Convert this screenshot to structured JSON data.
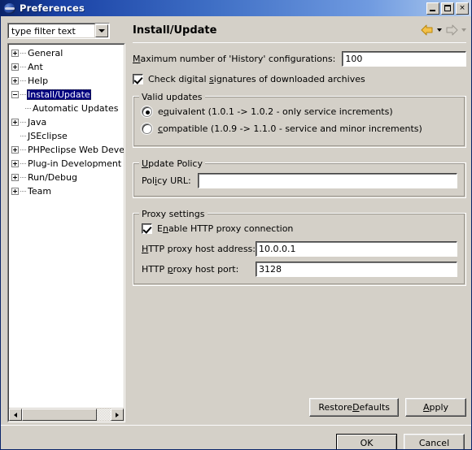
{
  "window": {
    "title": "Preferences",
    "icon": "eclipse-globe-icon",
    "minimize_label": "Minimize",
    "maximize_label": "Maximize",
    "close_label": "×"
  },
  "sidebar": {
    "filter": {
      "value": "type filter text",
      "placeholder": "type filter text"
    },
    "tree": [
      {
        "label": "General",
        "state": "collapsed",
        "level": 0,
        "selected": false
      },
      {
        "label": "Ant",
        "state": "collapsed",
        "level": 0,
        "selected": false
      },
      {
        "label": "Help",
        "state": "collapsed",
        "level": 0,
        "selected": false
      },
      {
        "label": "Install/Update",
        "state": "expanded",
        "level": 0,
        "selected": true
      },
      {
        "label": "Automatic Updates",
        "state": "leaf",
        "level": 1,
        "selected": false
      },
      {
        "label": "Java",
        "state": "collapsed",
        "level": 0,
        "selected": false
      },
      {
        "label": "JSEclipse",
        "state": "leaf",
        "level": 0,
        "selected": false
      },
      {
        "label": "PHPeclipse Web Developn",
        "state": "collapsed",
        "level": 0,
        "selected": false
      },
      {
        "label": "Plug-in Development",
        "state": "collapsed",
        "level": 0,
        "selected": false
      },
      {
        "label": "Run/Debug",
        "state": "collapsed",
        "level": 0,
        "selected": false
      },
      {
        "label": "Team",
        "state": "collapsed",
        "level": 0,
        "selected": false
      }
    ]
  },
  "page": {
    "title": "Install/Update",
    "nav": {
      "back": "back-arrow",
      "back_menu": "back-dropdown",
      "forward": "forward-arrow",
      "forward_menu": "forward-dropdown"
    },
    "history": {
      "label_pre": "",
      "label_mnemonic": "M",
      "label_post": "aximum number of 'History' configurations:",
      "value": "100"
    },
    "signatures": {
      "checked": true,
      "label_pre": "Check digital ",
      "label_mnemonic": "s",
      "label_post": "ignatures of downloaded archives"
    },
    "valid_updates": {
      "title": "Valid updates",
      "options": [
        {
          "selected": true,
          "pre": "e",
          "mnemonic": "q",
          "post": "uivalent (1.0.1 -> 1.0.2 - only service increments)"
        },
        {
          "selected": false,
          "pre": "",
          "mnemonic": "c",
          "post": "ompatible (1.0.9 -> 1.1.0 - service and minor increments)"
        }
      ]
    },
    "update_policy": {
      "title_pre": "",
      "title_mnemonic": "U",
      "title_post": "pdate Policy",
      "url_label_pre": "Pol",
      "url_label_mnemonic": "i",
      "url_label_post": "cy URL:",
      "url_value": ""
    },
    "proxy": {
      "title": "Proxy settings",
      "enable": {
        "checked": true,
        "pre": "E",
        "mnemonic": "n",
        "post": "able HTTP proxy connection"
      },
      "host": {
        "label_pre": "",
        "label_mnemonic": "H",
        "label_post": "TTP proxy host address:",
        "value": "10.0.0.1"
      },
      "port": {
        "label_pre": "HTTP ",
        "label_mnemonic": "p",
        "label_post": "roxy host port:",
        "value": "3128"
      }
    },
    "buttons": {
      "restore_pre": "Restore ",
      "restore_mnemonic": "D",
      "restore_post": "efaults",
      "apply_pre": "",
      "apply_mnemonic": "A",
      "apply_post": "pply"
    }
  },
  "footer": {
    "ok": "OK",
    "cancel": "Cancel"
  },
  "colors": {
    "selection": "#000080",
    "titlebar_start": "#0a246a",
    "titlebar_end": "#a6c4ec",
    "face": "#d4d0c8",
    "back_arrow": "#e8a317"
  }
}
